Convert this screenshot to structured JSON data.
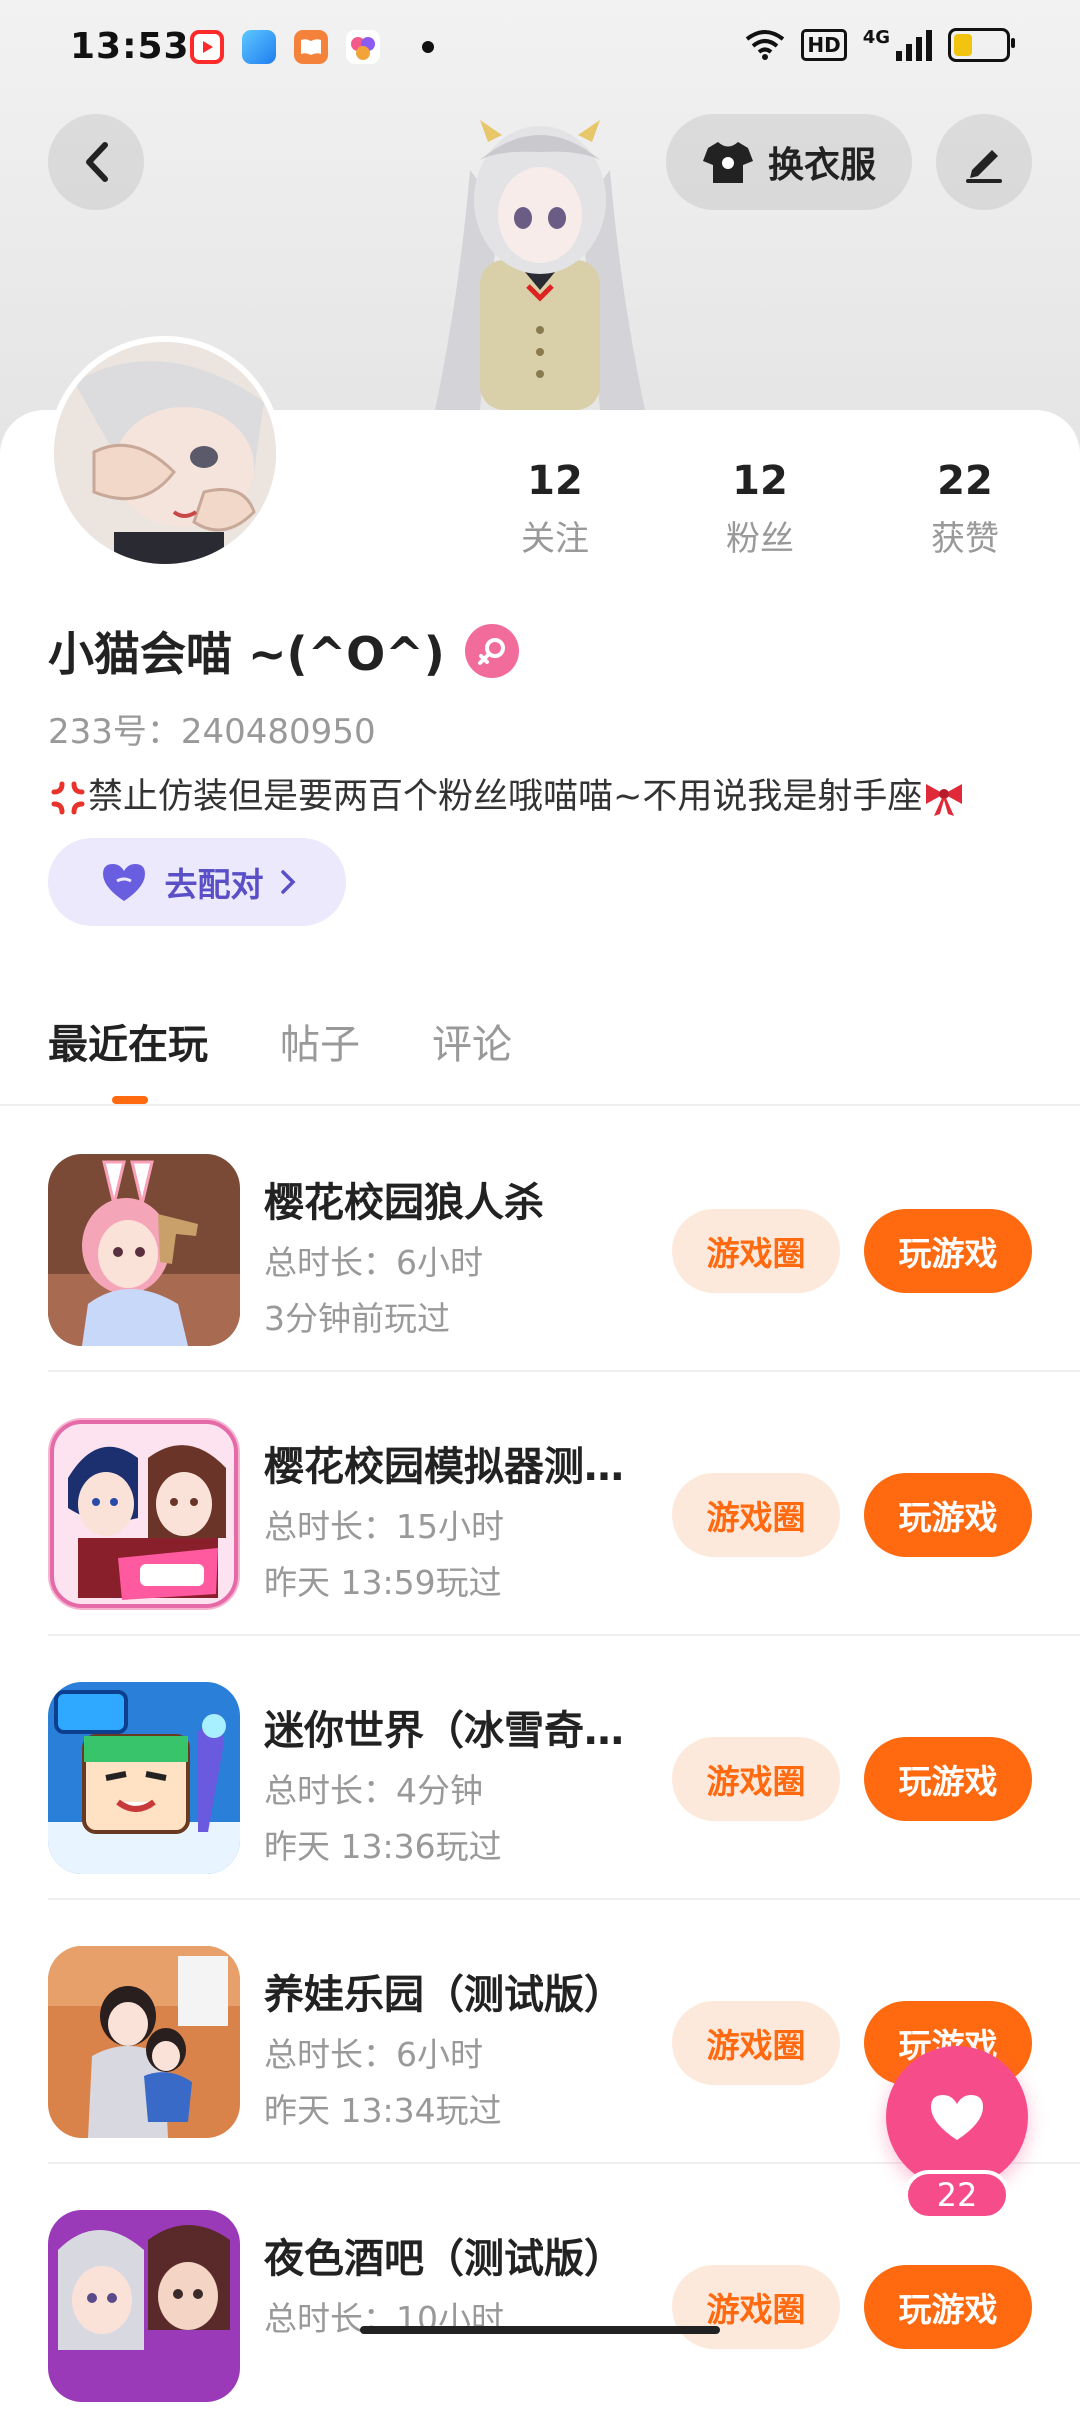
{
  "status_bar": {
    "time": "13:53",
    "icons": [
      "video-app-icon",
      "blue-app-icon",
      "book-app-icon",
      "game-app-icon",
      "notification-dot"
    ],
    "hd_label": "HD",
    "network_label": "4G",
    "battery_level": 0.35
  },
  "header": {
    "back_icon": "chevron-left-icon",
    "outfit_button": {
      "icon": "tshirt-icon",
      "label": "换衣服"
    },
    "edit_icon": "pen-icon"
  },
  "profile": {
    "stats": [
      {
        "value": "12",
        "label": "关注"
      },
      {
        "value": "12",
        "label": "粉丝"
      },
      {
        "value": "22",
        "label": "获赞"
      }
    ],
    "nickname": "小猫会喵 ~(^O^)",
    "gender_icon": "female-icon",
    "uid": "233号：240480950",
    "bio": "禁止仿装但是要两百个粉丝哦喵喵~不用说我是射手座",
    "match_button": {
      "icon": "heart-icon",
      "label": "去配对"
    }
  },
  "tabs": [
    {
      "label": "最近在玩",
      "active": true
    },
    {
      "label": "帖子",
      "active": false
    },
    {
      "label": "评论",
      "active": false
    }
  ],
  "games": [
    {
      "name": "樱花校园狼人杀",
      "duration": "总时长：6小时",
      "last_played": "3分钟前玩过",
      "circle_label": "游戏圈",
      "play_label": "玩游戏"
    },
    {
      "name": "樱花校园模拟器测…",
      "duration": "总时长：15小时",
      "last_played": "昨天 13:59玩过",
      "circle_label": "游戏圈",
      "play_label": "玩游戏"
    },
    {
      "name": "迷你世界（冰雪奇…",
      "duration": "总时长：4分钟",
      "last_played": "昨天 13:36玩过",
      "circle_label": "游戏圈",
      "play_label": "玩游戏"
    },
    {
      "name": "养娃乐园（测试版）",
      "duration": "总时长：6小时",
      "last_played": "昨天 13:34玩过",
      "circle_label": "游戏圈",
      "play_label": "玩游戏"
    },
    {
      "name": "夜色酒吧（测试版）",
      "duration": "总时长：10小时",
      "last_played": "",
      "circle_label": "游戏圈",
      "play_label": "玩游戏"
    }
  ],
  "like_fab": {
    "icon": "heart-icon",
    "count": "22"
  },
  "colors": {
    "accent": "#ff6a10",
    "accent_light": "#fde9dc",
    "match_bg": "#ebe9fb",
    "match_text": "#5a4fc7",
    "fab": "#f64d8a",
    "gender": "#f26c9b"
  }
}
